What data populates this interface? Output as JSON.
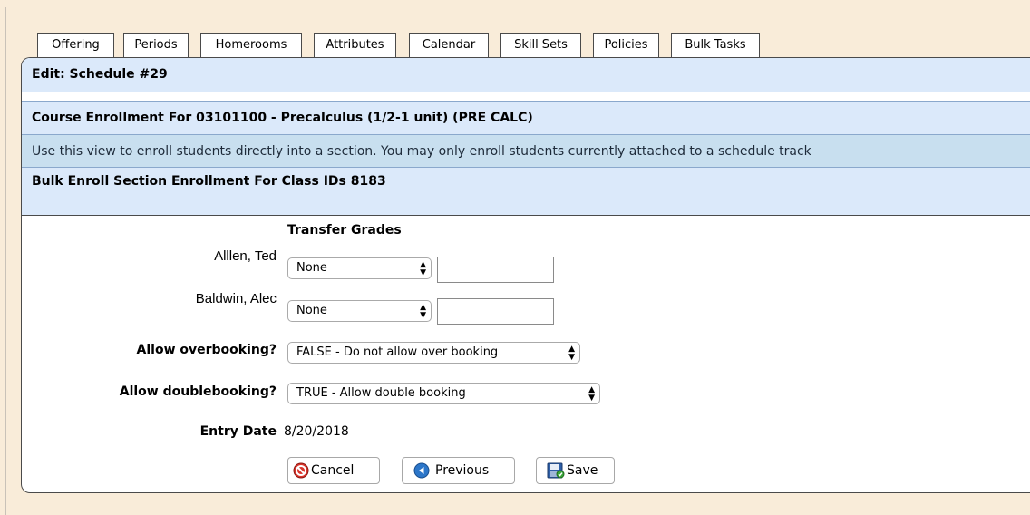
{
  "tabs": [
    {
      "label": "Offering",
      "active": true
    },
    {
      "label": "Periods",
      "active": false
    },
    {
      "label": "Homerooms",
      "active": false
    },
    {
      "label": "Attributes",
      "active": false
    },
    {
      "label": "Calendar",
      "active": false
    },
    {
      "label": "Skill Sets",
      "active": false
    },
    {
      "label": "Policies",
      "active": false
    },
    {
      "label": "Bulk Tasks",
      "active": false
    }
  ],
  "edit_title": "Edit: Schedule #29",
  "course_title": "Course Enrollment For 03101100 - Precalculus (1/2-1 unit) (PRE CALC)",
  "info_text": "Use this view to enroll students directly into a section. You may only enroll students currently attached to a schedule track",
  "bulk_title": "Bulk Enroll Section Enrollment For Class IDs 8183",
  "form": {
    "transfer_grades_label": "Transfer Grades",
    "students": [
      {
        "name": "Alllen, Ted",
        "grade_selected": "None",
        "grade_text": ""
      },
      {
        "name": "Baldwin, Alec",
        "grade_selected": "None",
        "grade_text": ""
      }
    ],
    "overbooking_label": "Allow overbooking?",
    "overbooking_value": "FALSE - Do not allow over booking",
    "doublebooking_label": "Allow doublebooking?",
    "doublebooking_value": "TRUE - Allow double booking",
    "entry_date_label": "Entry Date",
    "entry_date_value": "8/20/2018"
  },
  "buttons": {
    "cancel": "Cancel",
    "previous": "Previous",
    "save": "Save"
  },
  "colors": {
    "page_bg": "#f9ecd9",
    "header_bg": "#dbe9fa",
    "info_bg": "#c8dfef",
    "cancel_icon": "#d9342b",
    "previous_icon": "#2c76c9",
    "save_icon": "#2e5fa8"
  }
}
